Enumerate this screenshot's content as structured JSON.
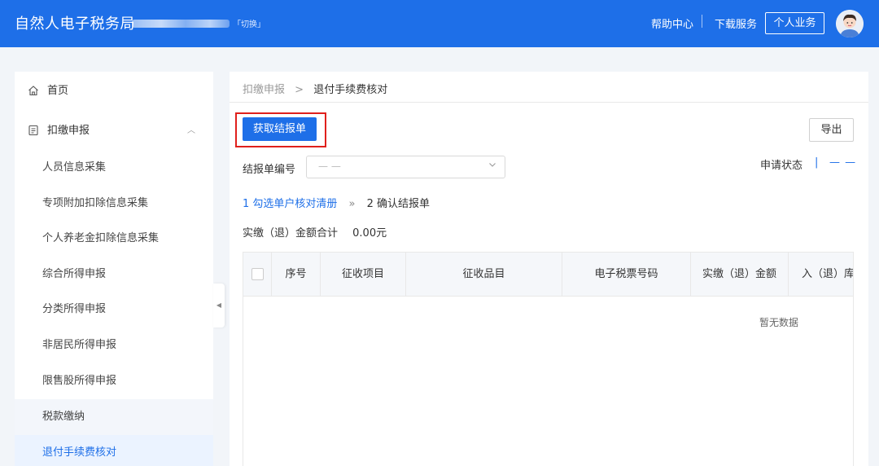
{
  "header": {
    "brand": "自然人电子税务局",
    "switch_label": "「切换」",
    "help_label": "帮助中心",
    "download_label": "下载服务",
    "personal_label": "个人业务"
  },
  "sidebar": {
    "home": "首页",
    "withholding": "扣缴申报",
    "items": [
      "人员信息采集",
      "专项附加扣除信息采集",
      "个人养老金扣除信息采集",
      "综合所得申报",
      "分类所得申报",
      "非居民所得申报",
      "限售股所得申报",
      "税款缴纳",
      "退付手续费核对"
    ]
  },
  "breadcrumb": {
    "parent": "扣缴申报",
    "separator": ">",
    "current": "退付手续费核对"
  },
  "toolbar": {
    "fetch_label": "获取结报单",
    "export_label": "导出"
  },
  "filter": {
    "label": "结报单编号",
    "select_value": "— —",
    "status_label": "申请状态",
    "status_separator": "|",
    "status_value": "— —"
  },
  "steps": {
    "step1": "1 勾选单户核对清册",
    "arrow": "»",
    "step2": "2 确认结报单"
  },
  "summary": {
    "label": "实缴（退）金额合计",
    "value": "0.00元"
  },
  "table": {
    "columns": [
      "序号",
      "征收项目",
      "征收品目",
      "电子税票号码",
      "实缴（退）金额",
      "入（退）库"
    ],
    "empty_text": "暂无数据"
  },
  "colors": {
    "primary": "#1e6fe8",
    "highlight": "#e0201c"
  }
}
